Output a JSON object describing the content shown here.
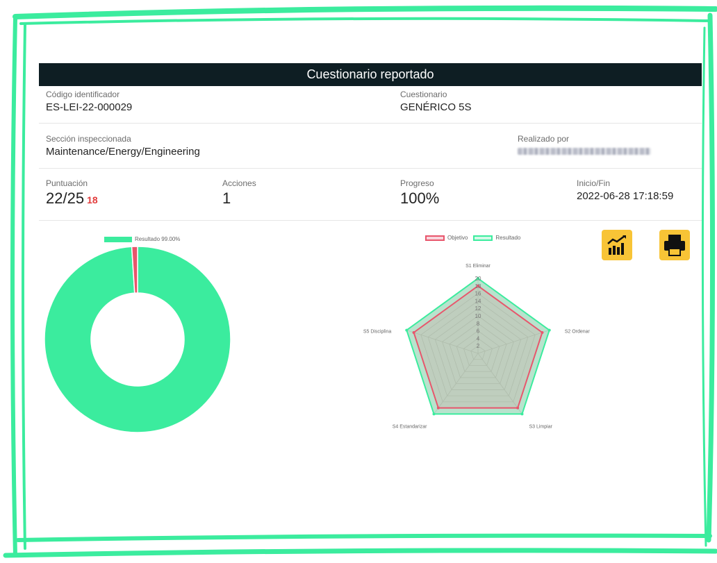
{
  "header": {
    "title": "Cuestionario reportado"
  },
  "info": {
    "codigo_label": "Código identificador",
    "codigo_value": "ES-LEI-22-000029",
    "cuestionario_label": "Cuestionario",
    "cuestionario_value": "GENÉRICO 5S",
    "seccion_label": "Sección inspeccionada",
    "seccion_value": "Maintenance/Energy/Engineering",
    "realizado_label": "Realizado por",
    "puntuacion_label": "Puntuación",
    "puntuacion_value": "22/25",
    "puntuacion_badge": "18",
    "acciones_label": "Acciones",
    "acciones_value": "1",
    "progreso_label": "Progreso",
    "progreso_value": "100%",
    "inicio_label": "Inicio/Fin",
    "inicio_value": "2022-06-28 17:18:59"
  },
  "colors": {
    "accent": "#3bec9e",
    "red": "#e8566c",
    "title_bg": "#0e1e23",
    "button": "#f8c436"
  },
  "icons": {
    "chart_button": "chart-report-icon",
    "print_button": "printer-icon"
  },
  "chart_data": [
    {
      "type": "pie",
      "variant": "doughnut",
      "legend": [
        {
          "label": "Resultado 99.00%"
        }
      ],
      "values": [
        99,
        1
      ],
      "colors": [
        "#3bec9e",
        "#e8566c"
      ],
      "legend_position": "top"
    },
    {
      "type": "radar",
      "categories": [
        "S1 Eliminar",
        "S2 Ordenar",
        "S3 Limpiar",
        "S4 Estandarizar",
        "S5 Disciplina"
      ],
      "series": [
        {
          "name": "Objetivo",
          "values": [
            18,
            18,
            18,
            18,
            18
          ],
          "color": "#e8566c"
        },
        {
          "name": "Resultado",
          "values": [
            20,
            20,
            20,
            20,
            20
          ],
          "color": "#3bec9e"
        }
      ],
      "rlim": [
        0,
        20
      ],
      "ticks": [
        "2",
        "4",
        "6",
        "8",
        "10",
        "12",
        "14",
        "16",
        "18",
        "20"
      ],
      "legend_position": "top"
    }
  ]
}
